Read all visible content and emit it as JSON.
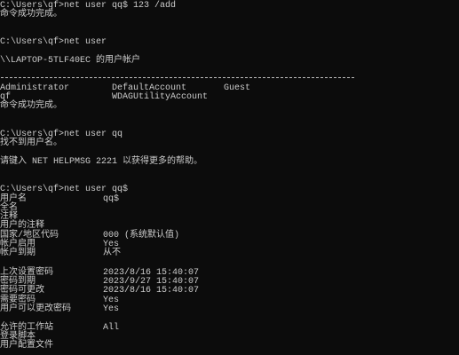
{
  "terminal": {
    "colors": {
      "background": "#0c0c0c",
      "text": "#cccccc"
    },
    "block1": {
      "prompt": "C:\\Users\\qf>",
      "command": "net user qq$ 123 /add",
      "result": "命令成功完成。"
    },
    "block2": {
      "prompt": "C:\\Users\\qf>",
      "command": "net user",
      "header": "\\\\LAPTOP-5TLF40EC 的用户帐户",
      "accounts": [
        "Administrator",
        "DefaultAccount",
        "Guest",
        "qf",
        "WDAGUtilityAccount"
      ],
      "result": "命令成功完成。"
    },
    "block3": {
      "prompt": "C:\\Users\\qf>",
      "command": "net user qq",
      "error": "找不到用户名。",
      "help": "请键入 NET HELPMSG 2221 以获得更多的帮助。"
    },
    "block4": {
      "prompt": "C:\\Users\\qf>",
      "command": "net user qq$",
      "fields": [
        {
          "label": "用户名",
          "value": "qq$"
        },
        {
          "label": "全名",
          "value": ""
        },
        {
          "label": "注释",
          "value": ""
        },
        {
          "label": "用户的注释",
          "value": ""
        },
        {
          "label": "国家/地区代码",
          "value": "000 (系统默认值)"
        },
        {
          "label": "帐户启用",
          "value": "Yes"
        },
        {
          "label": "帐户到期",
          "value": "从不"
        },
        {
          "label": "上次设置密码",
          "value": "2023/8/16 15:40:07"
        },
        {
          "label": "密码到期",
          "value": "2023/9/27 15:40:07"
        },
        {
          "label": "密码可更改",
          "value": "2023/8/16 15:40:07"
        },
        {
          "label": "需要密码",
          "value": "Yes"
        },
        {
          "label": "用户可以更改密码",
          "value": "Yes"
        },
        {
          "label": "允许的工作站",
          "value": "All"
        },
        {
          "label": "登录脚本",
          "value": ""
        },
        {
          "label": "用户配置文件",
          "value": ""
        }
      ]
    }
  }
}
